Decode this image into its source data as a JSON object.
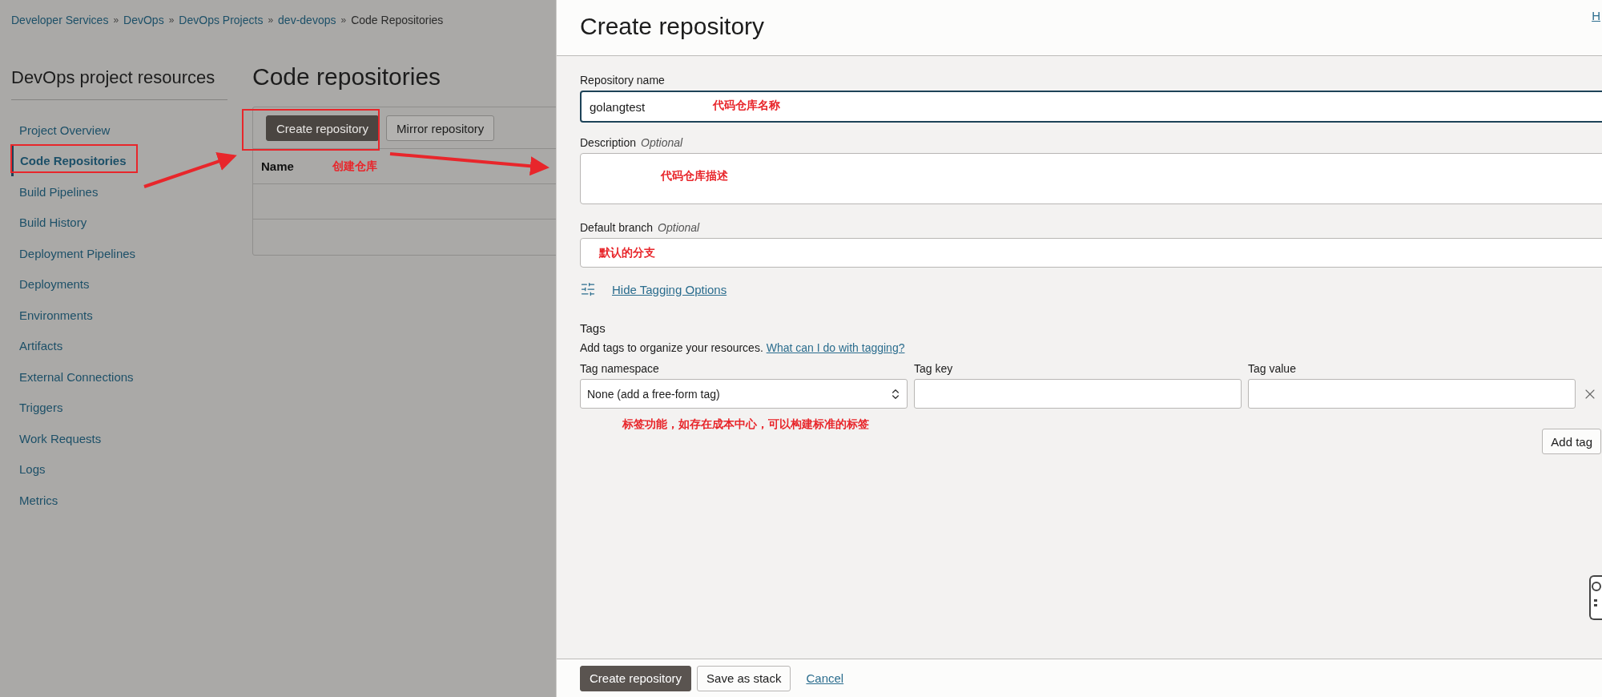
{
  "breadcrumb": [
    {
      "label": "Developer Services",
      "link": true,
      "sep": "»"
    },
    {
      "label": "DevOps",
      "link": true,
      "sep": "»"
    },
    {
      "label": "DevOps Projects",
      "link": true,
      "sep": "»"
    },
    {
      "label": "dev-devops",
      "link": true,
      "sep": "»"
    },
    {
      "label": "Code Repositories",
      "link": false
    }
  ],
  "sidebar": {
    "title": "DevOps project resources",
    "items": [
      {
        "label": "Project Overview",
        "selected": false
      },
      {
        "label": "Code Repositories",
        "selected": true
      },
      {
        "label": "Build Pipelines",
        "selected": false
      },
      {
        "label": "Build History",
        "selected": false
      },
      {
        "label": "Deployment Pipelines",
        "selected": false
      },
      {
        "label": "Deployments",
        "selected": false
      },
      {
        "label": "Environments",
        "selected": false
      },
      {
        "label": "Artifacts",
        "selected": false
      },
      {
        "label": "External Connections",
        "selected": false
      },
      {
        "label": "Triggers",
        "selected": false
      },
      {
        "label": "Work Requests",
        "selected": false
      },
      {
        "label": "Logs",
        "selected": false
      },
      {
        "label": "Metrics",
        "selected": false
      }
    ]
  },
  "main": {
    "title": "Code repositories",
    "toolbar": [
      {
        "label": "Create repository",
        "primary": true
      },
      {
        "label": "Mirror repository",
        "primary": false
      }
    ],
    "table": {
      "columns": [
        "Name"
      ],
      "annotation": "创建仓库"
    }
  },
  "panel": {
    "title": "Create repository",
    "header_link": "H",
    "fields": [
      {
        "kind": "input",
        "label": "Repository name",
        "value": "golangtest",
        "focused": true,
        "annotation": "代码仓库名称"
      },
      {
        "kind": "textarea",
        "label": "Description",
        "hint": "Optional",
        "annotation": "代码仓库描述"
      },
      {
        "kind": "input",
        "label": "Default branch",
        "hint": "Optional",
        "focused": false,
        "annotation": "默认的分支"
      }
    ],
    "tagging_toggle": "Hide Tagging Options",
    "tags": {
      "title": "Tags",
      "help_text": "Add tags to organize your resources.",
      "help_link": "What can I do with tagging?",
      "columns": [
        "Tag namespace",
        "Tag key",
        "Tag value"
      ],
      "namespace_value": "None (add a free-form tag)",
      "annotation": "标签功能，如存在成本中心，可以构建标准的标签",
      "add_button": "Add tag"
    },
    "footer": [
      {
        "label": "Create repository",
        "kind": "primary"
      },
      {
        "label": "Save as stack",
        "kind": "secondary"
      },
      {
        "label": "Cancel",
        "kind": "link"
      }
    ]
  }
}
